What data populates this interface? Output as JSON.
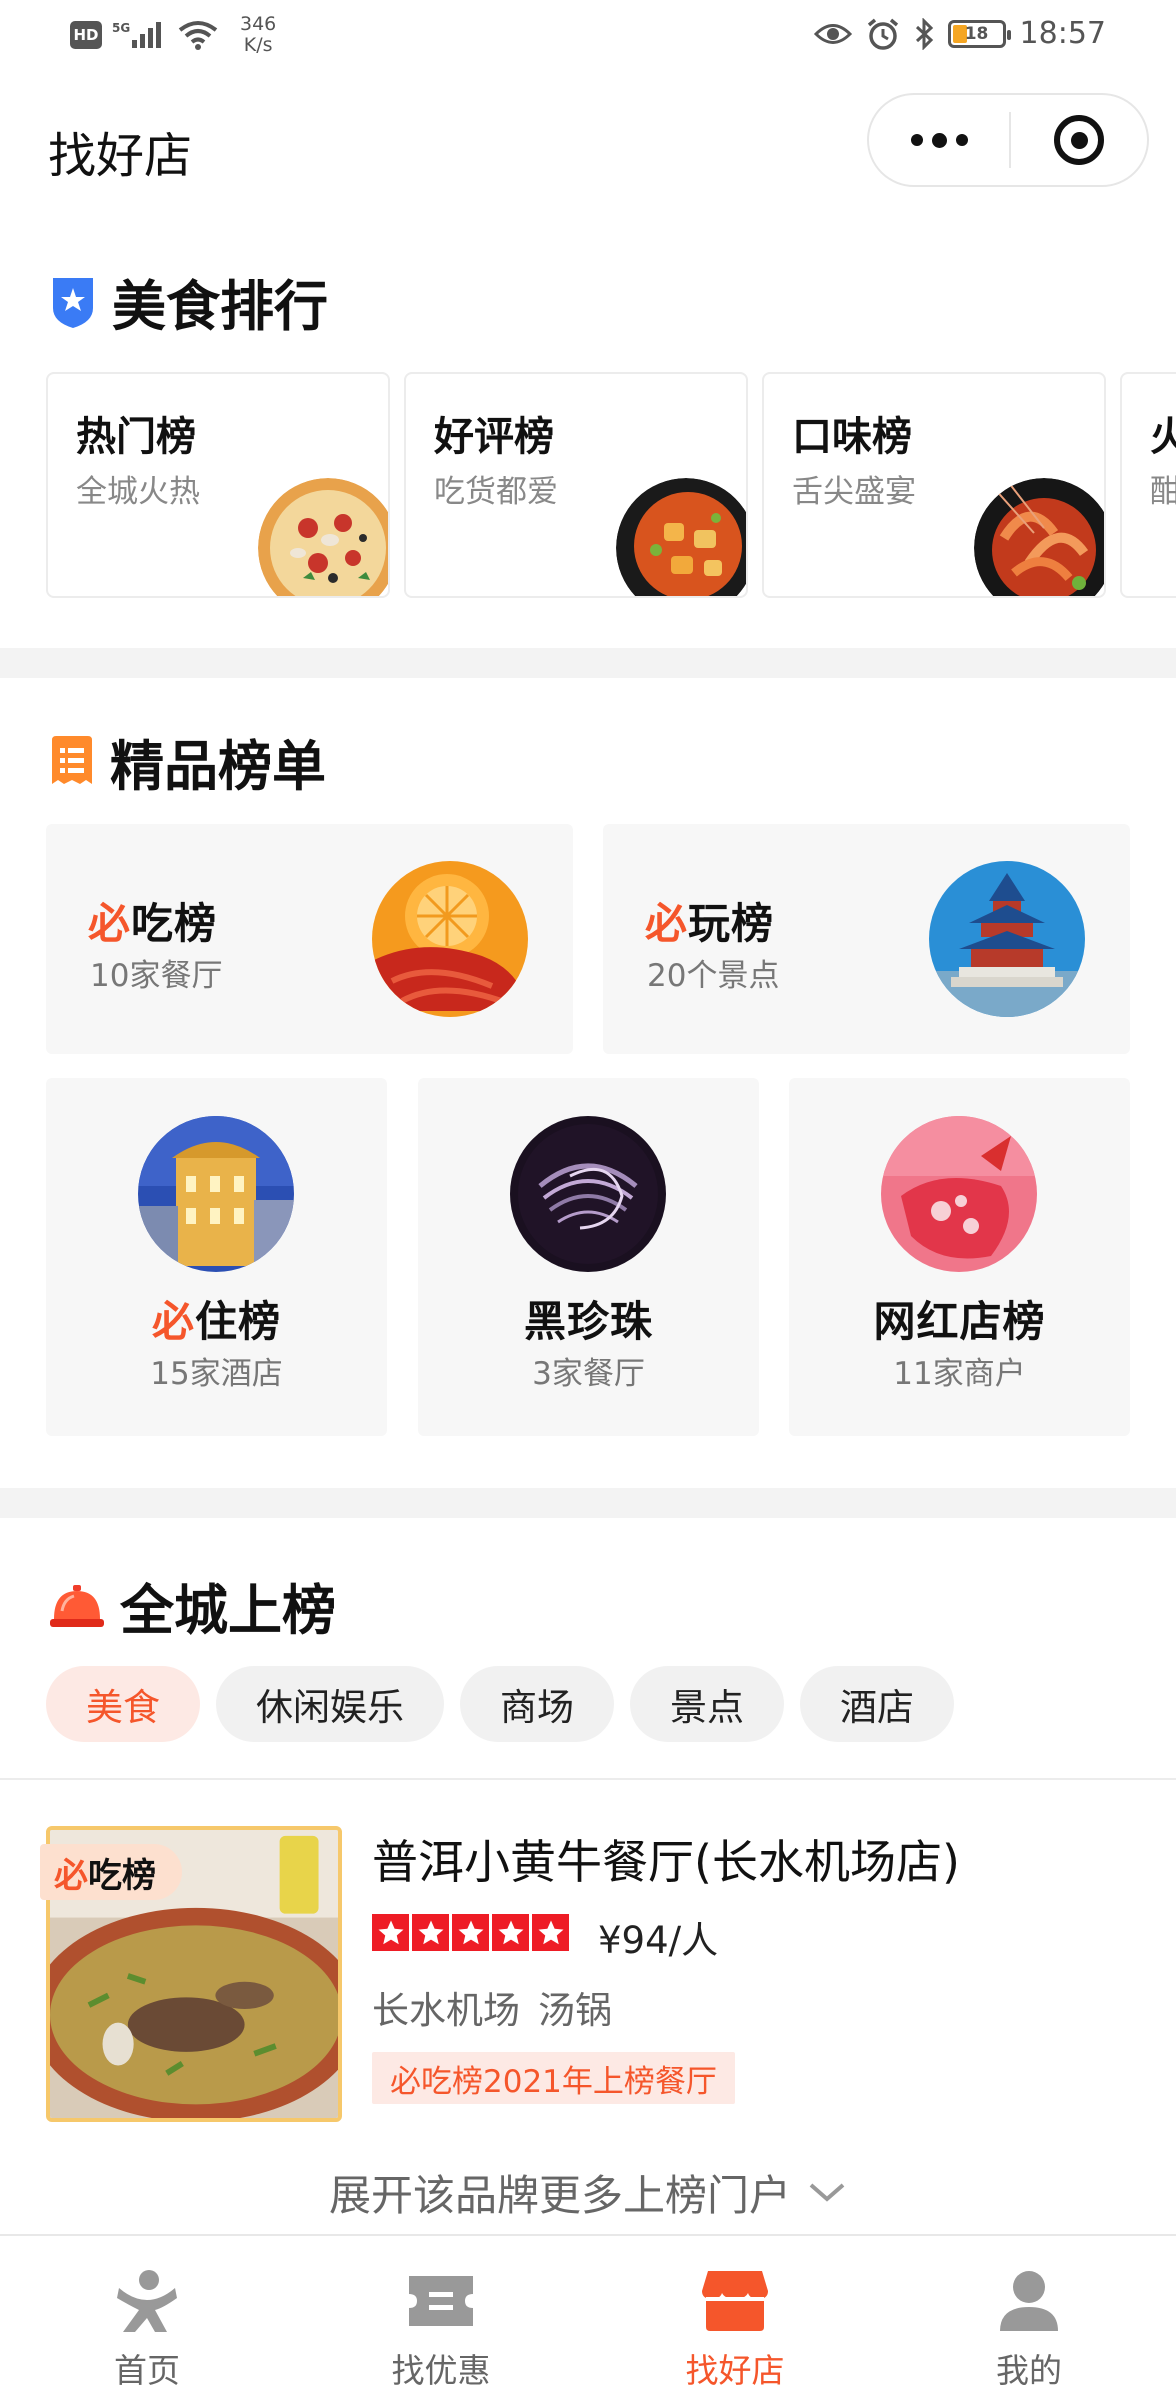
{
  "status_bar": {
    "hd": "HD",
    "net": "5G",
    "speed_value": "346",
    "speed_unit": "K/s",
    "battery": "18",
    "time": "18:57"
  },
  "nav": {
    "title": "找好店"
  },
  "food_ranking": {
    "title": "美食排行",
    "cards": [
      {
        "title": "热门榜",
        "subtitle": "全城火热"
      },
      {
        "title": "好评榜",
        "subtitle": "吃货都爱"
      },
      {
        "title": "口味榜",
        "subtitle": "舌尖盛宴"
      },
      {
        "title": "火",
        "subtitle": "酣"
      }
    ]
  },
  "premium": {
    "title": "精品榜单",
    "big": [
      {
        "mark": "必",
        "name": "吃榜",
        "count": "10家餐厅"
      },
      {
        "mark": "必",
        "name": "玩榜",
        "count": "20个景点"
      }
    ],
    "small": [
      {
        "mark": "必",
        "name": "住榜",
        "count": "15家酒店"
      },
      {
        "mark": "",
        "name": "黑珍珠",
        "count": "3家餐厅"
      },
      {
        "mark": "",
        "name": "网红店榜",
        "count": "11家商户"
      }
    ]
  },
  "city_list": {
    "title": "全城上榜",
    "chips": [
      "美食",
      "休闲娱乐",
      "商场",
      "景点",
      "酒店"
    ],
    "active_chip": "美食"
  },
  "shop": {
    "tag_mark": "必",
    "tag_text": "吃榜",
    "name": "普洱小黄牛餐厅(长水机场店)",
    "rating": 5,
    "price": "¥94/人",
    "area": "长水机场",
    "category": "汤锅",
    "badge": "必吃榜2021年上榜餐厅",
    "expand": "展开该品牌更多上榜门户"
  },
  "tabs": [
    {
      "label": "首页",
      "icon": "home-person-icon"
    },
    {
      "label": "找优惠",
      "icon": "ticket-icon"
    },
    {
      "label": "找好店",
      "icon": "shop-icon",
      "active": true
    },
    {
      "label": "我的",
      "icon": "user-icon"
    }
  ],
  "colors": {
    "accent": "#f5562b",
    "star": "#ee1c25",
    "blue": "#3a7bf5"
  }
}
